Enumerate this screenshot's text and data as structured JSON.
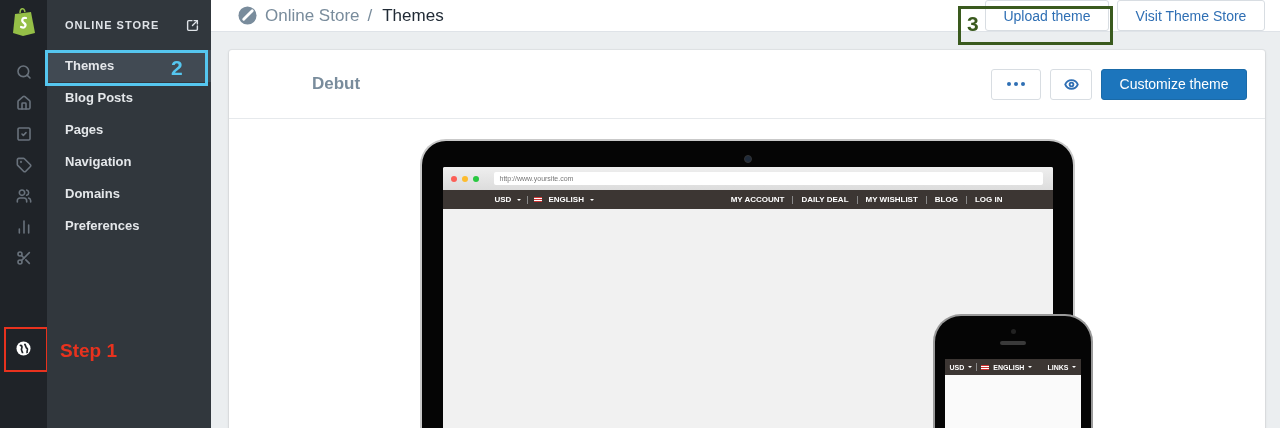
{
  "sidebar": {
    "heading": "ONLINE STORE",
    "items": [
      {
        "label": "Themes",
        "selected": true
      },
      {
        "label": "Blog Posts",
        "selected": false
      },
      {
        "label": "Pages",
        "selected": false
      },
      {
        "label": "Navigation",
        "selected": false
      },
      {
        "label": "Domains",
        "selected": false
      },
      {
        "label": "Preferences",
        "selected": false
      }
    ]
  },
  "breadcrumb": {
    "parent": "Online Store",
    "separator": "/",
    "current": "Themes"
  },
  "header_buttons": [
    "Upload theme",
    "Visit Theme Store"
  ],
  "theme": {
    "name": "Debut",
    "primary_action": "Customize theme"
  },
  "preview": {
    "url": "http://www.yoursite.com",
    "currency": "USD",
    "language": "ENGLISH",
    "links": [
      "MY ACCOUNT",
      "DAILY DEAL",
      "MY WISHLIST",
      "BLOG",
      "LOG IN"
    ],
    "phone": {
      "currency": "USD",
      "language": "ENGLISH",
      "menu": "LINKS"
    }
  },
  "annotations": [
    {
      "text": "Step 1",
      "color": "#e8321e"
    },
    {
      "text": "2",
      "color": "#55c6ef"
    },
    {
      "text": "3",
      "color": "#3a5a1e"
    }
  ]
}
